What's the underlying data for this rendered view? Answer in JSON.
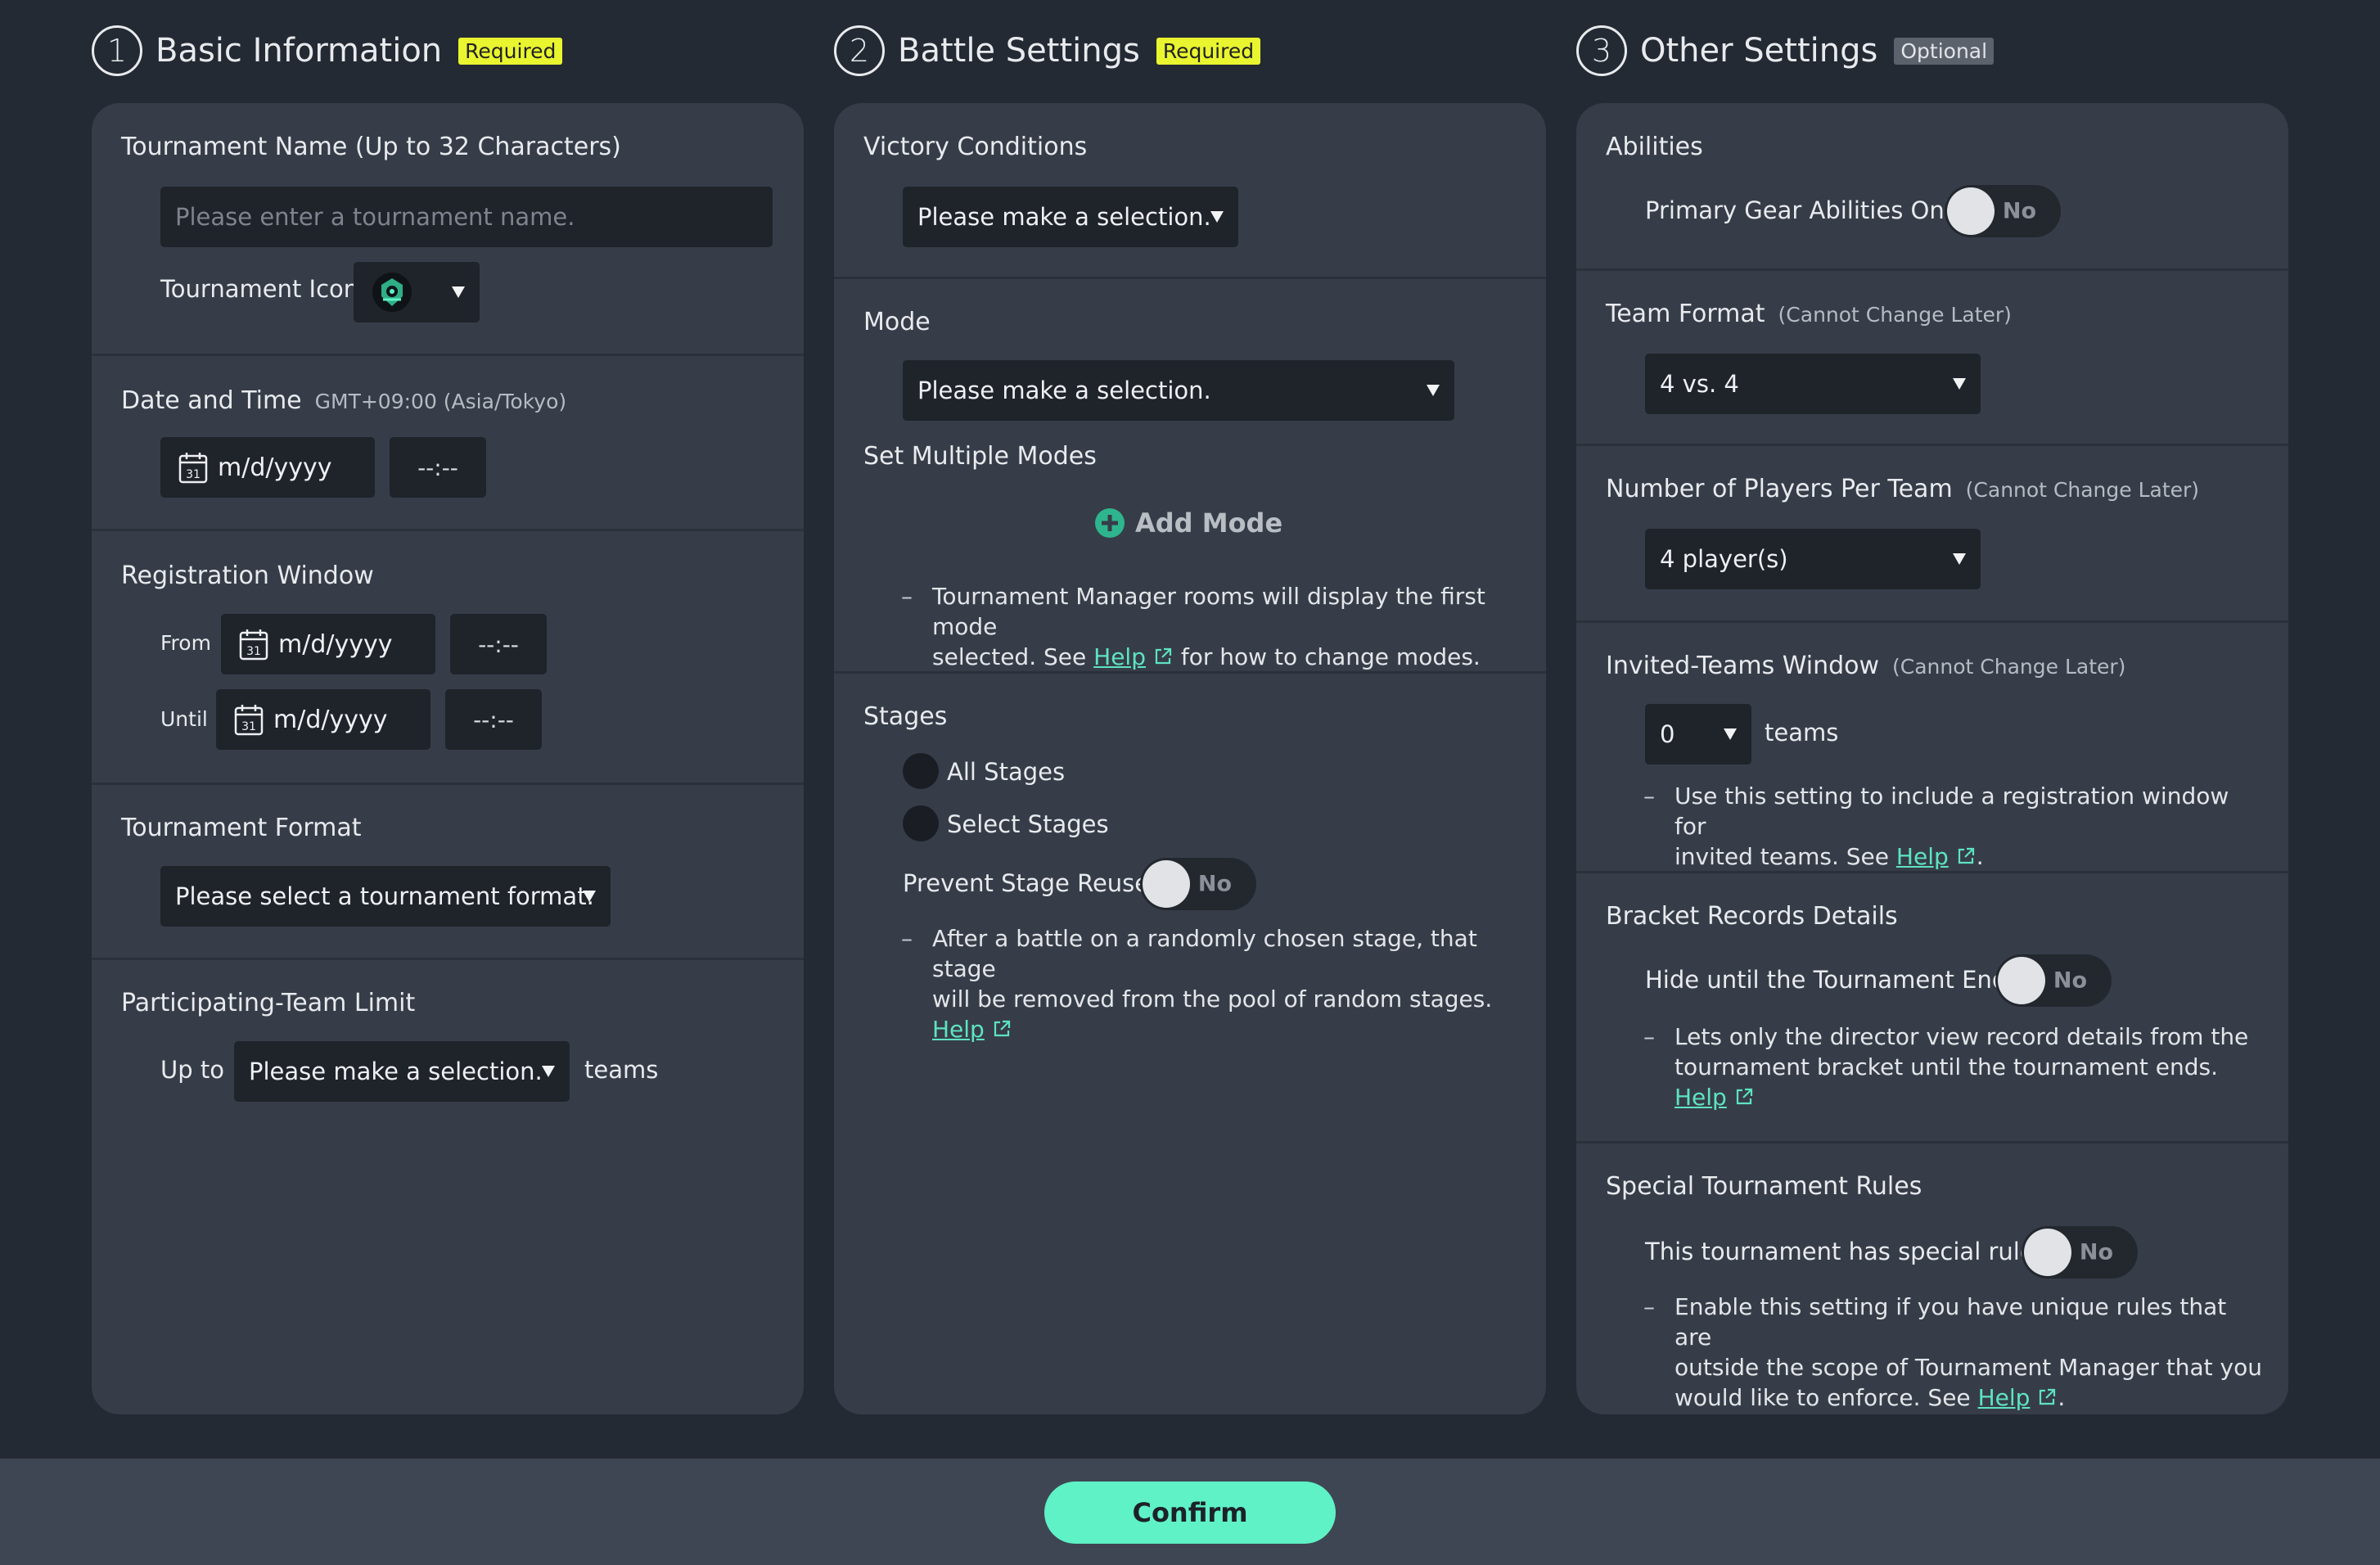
{
  "columns": [
    {
      "num": "1",
      "title": "Basic Information",
      "badge": "Required"
    },
    {
      "num": "2",
      "title": "Battle Settings",
      "badge": "Required"
    },
    {
      "num": "3",
      "title": "Other Settings",
      "badge": "Optional"
    }
  ],
  "basic": {
    "name_title": "Tournament Name (Up to 32 Characters)",
    "name_placeholder": "Please enter a tournament name.",
    "icon_label": "Tournament Icon",
    "date_title": "Date and Time",
    "date_tz": "GMT+09:00 (Asia/Tokyo)",
    "date_placeholder": "m/d/yyyy",
    "time_placeholder": "--:--",
    "cal_day": "31",
    "reg_title": "Registration Window",
    "reg_from": "From",
    "reg_until": "Until",
    "format_title": "Tournament Format",
    "format_select": "Please select a tournament format.",
    "limit_title": "Participating-Team Limit",
    "limit_prefix": "Up to",
    "limit_select": "Please make a selection.",
    "limit_suffix": "teams"
  },
  "battle": {
    "victory_title": "Victory Conditions",
    "victory_select": "Please make a selection.",
    "mode_title": "Mode",
    "mode_select": "Please make a selection.",
    "multi_title": "Set Multiple Modes",
    "add_mode": "Add Mode",
    "mode_note_1": "Tournament Manager rooms will display the first mode",
    "mode_note_2a": "selected. See",
    "help": "Help",
    "mode_note_2b": "for how to change modes.",
    "stages_title": "Stages",
    "all_stages": "All Stages",
    "select_stages": "Select Stages",
    "prevent_reuse": "Prevent Stage Reuse",
    "toggle_no": "No",
    "stage_note_1": "After a battle on a randomly chosen stage, that stage",
    "stage_note_2": "will be removed from the pool of random stages."
  },
  "other": {
    "abilities_title": "Abilities",
    "primary_gear": "Primary Gear Abilities Only",
    "toggle_no": "No",
    "team_format_title": "Team Format",
    "cannot_change": "(Cannot Change Later)",
    "team_format_select": "4 vs. 4",
    "players_title": "Number of Players Per Team",
    "players_select": "4 player(s)",
    "invited_title": "Invited-Teams Window",
    "invited_select": "0",
    "invited_suffix": "teams",
    "invited_note_1": "Use this setting to include a registration window for",
    "invited_note_2a": "invited teams. See",
    "help": "Help",
    "period": ".",
    "bracket_title": "Bracket Records Details",
    "hide_until": "Hide until the Tournament Ends",
    "bracket_note_1": "Lets only the director view record details from the",
    "bracket_note_2": "tournament bracket until the tournament ends.",
    "special_title": "Special Tournament Rules",
    "special_label": "This tournament has special rules.",
    "special_note_1": "Enable this setting if you have unique rules that are",
    "special_note_2": "outside the scope of Tournament Manager that you",
    "special_note_3a": "would like to enforce. See"
  },
  "footer": {
    "confirm": "Confirm"
  },
  "colors": {
    "accent": "#5ff2c6",
    "required_badge": "#e9f52f",
    "panel": "#363d48",
    "background": "#242a33"
  }
}
